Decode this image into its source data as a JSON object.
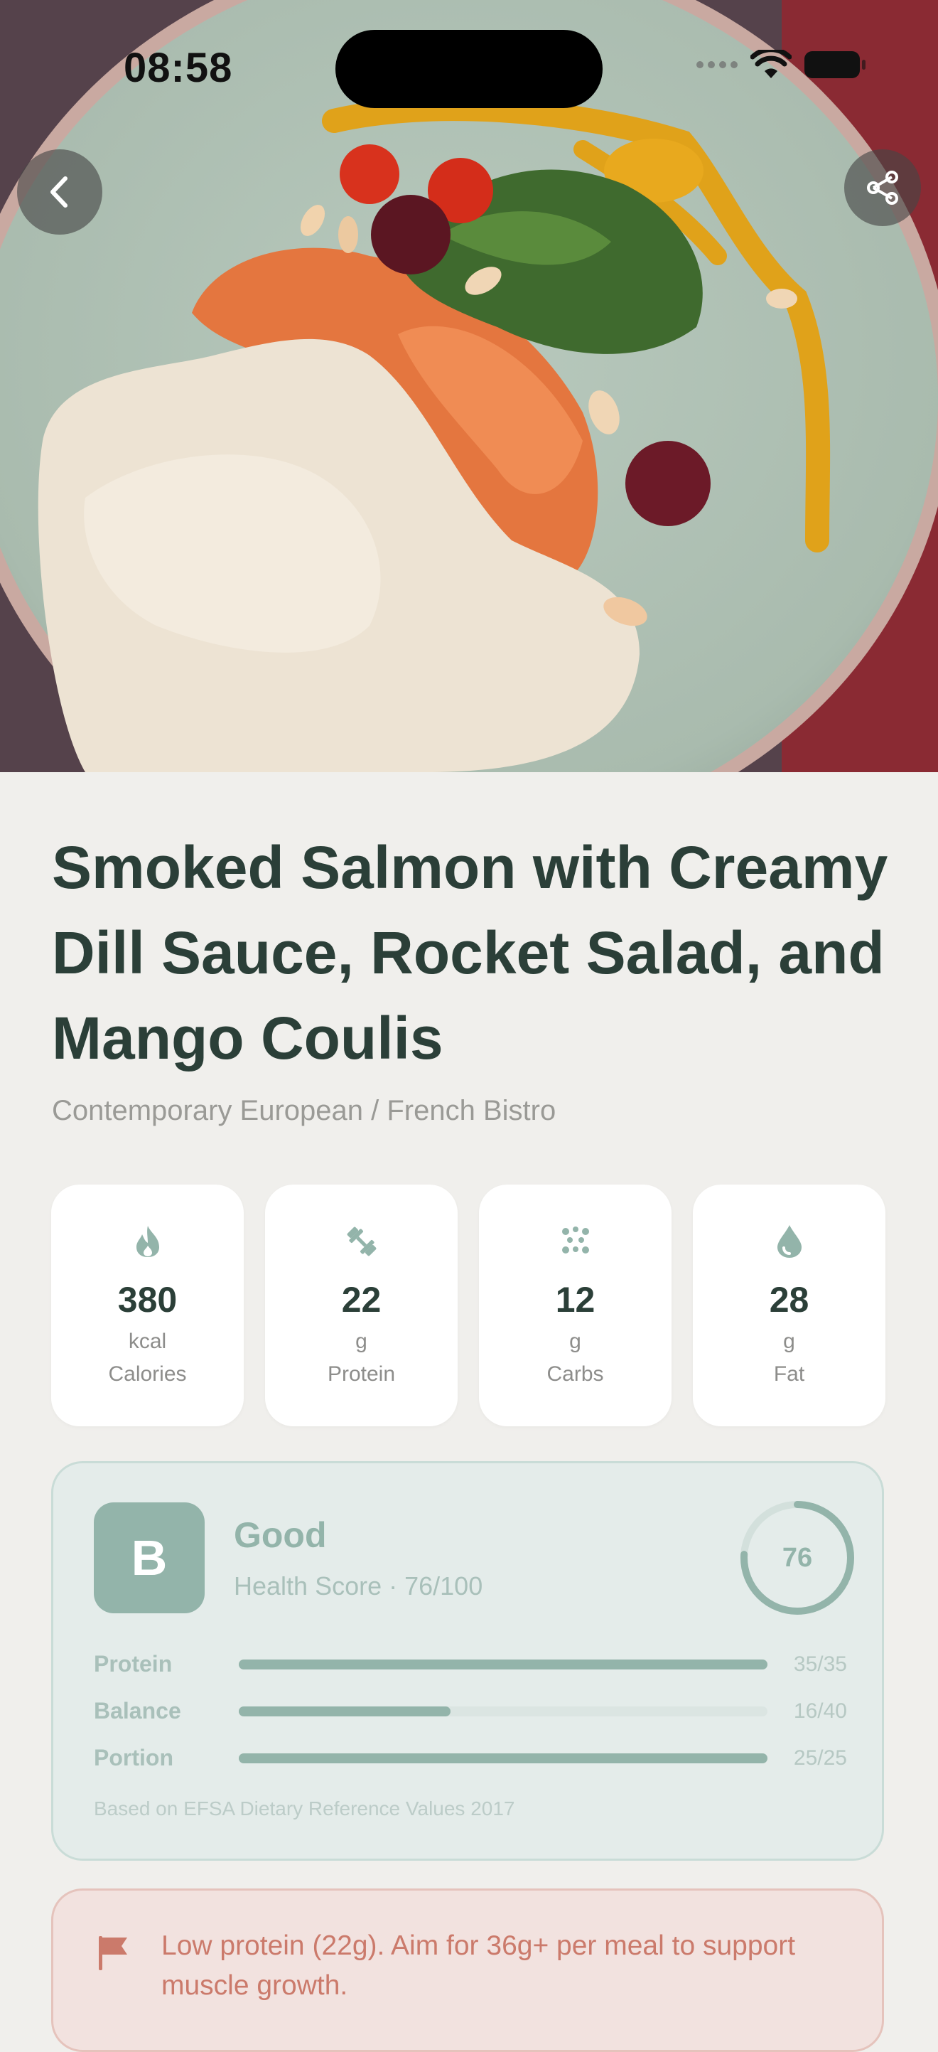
{
  "status_bar": {
    "time": "08:58"
  },
  "hero": {
    "back_icon": "chevron-left-icon",
    "share_icon": "share-icon"
  },
  "dish": {
    "title": "Smoked Salmon with Creamy Dill Sauce, Rocket Salad, and Mango Coulis",
    "cuisine": "Contemporary European / French Bistro"
  },
  "macros": [
    {
      "icon": "flame-icon",
      "value": "380",
      "unit": "kcal",
      "label": "Calories"
    },
    {
      "icon": "dumbbell-icon",
      "value": "22",
      "unit": "g",
      "label": "Protein"
    },
    {
      "icon": "grain-icon",
      "value": "12",
      "unit": "g",
      "label": "Carbs"
    },
    {
      "icon": "drop-icon",
      "value": "28",
      "unit": "g",
      "label": "Fat"
    }
  ],
  "health_score": {
    "grade": "B",
    "rating": "Good",
    "score_text": "Health Score · 76/100",
    "score": 76,
    "score_max": 100,
    "bars": [
      {
        "label": "Protein",
        "value_text": "35/35",
        "fraction": 1.0
      },
      {
        "label": "Balance",
        "value_text": "16/40",
        "fraction": 0.4
      },
      {
        "label": "Portion",
        "value_text": "25/25",
        "fraction": 1.0
      }
    ],
    "source": "Based on EFSA Dietary Reference Values 2017",
    "accent_color": "#93b4aa"
  },
  "warning": {
    "icon": "flag-icon",
    "text": "Low protein (22g). Aim for 36g+ per meal to support muscle growth.",
    "color": "#cb7a6b"
  }
}
